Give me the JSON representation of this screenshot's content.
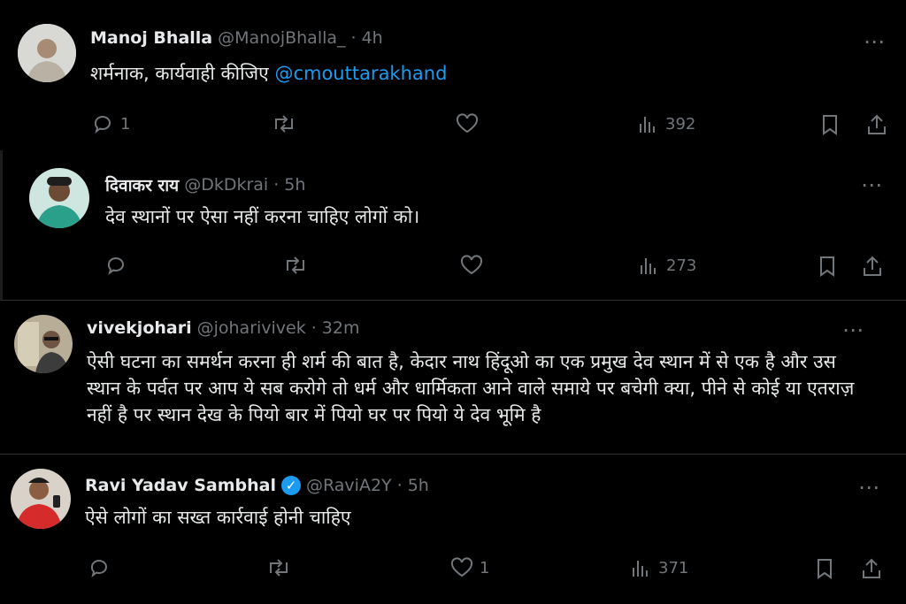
{
  "posts": [
    {
      "name": "Manoj Bhalla",
      "handle": "@ManojBhalla_",
      "sep": "·",
      "time": "4h",
      "text": "शर्मनाक, कार्यवाही कीजिए",
      "mention": "@cmouttarakhand",
      "replies": "1",
      "retweets": "",
      "likes": "",
      "views": "392"
    },
    {
      "name": "दिवाकर राय",
      "handle": "@DkDkrai",
      "sep": "·",
      "time": "5h",
      "text": "देव स्थानों पर ऐसा नहीं करना चाहिए लोगों को।",
      "replies": "",
      "retweets": "",
      "likes": "",
      "views": "273"
    },
    {
      "name": "vivekjohari",
      "handle": "@joharivivek",
      "sep": "·",
      "time": "32m",
      "text": "ऐसी घटना का समर्थन करना ही शर्म की बात है, केदार नाथ हिंदूओ का एक प्रमुख देव स्थान में से एक है और उस स्थान के पर्वत पर आप ये सब करोगे तो धर्म और धार्मिकता आने वाले समाये पर बचेगी क्या, पीने से कोई या एतराज़ नहीं है पर स्थान देख के पियो बार में पियो घर पर पियो ये देव भूमि है"
    },
    {
      "name": "Ravi Yadav Sambhal",
      "verified": true,
      "handle": "@RaviA2Y",
      "sep": "·",
      "time": "5h",
      "text": "ऐसे लोगों का सख्त कार्रवाई होनी चाहिए",
      "replies": "",
      "retweets": "",
      "likes": "1",
      "views": "371"
    }
  ],
  "icons": {
    "more": "⋯",
    "verified": "✓"
  },
  "colors": {
    "background": "#000000",
    "text": "#e7e9ea",
    "secondary": "#71767b",
    "accent": "#1d9bf0"
  }
}
